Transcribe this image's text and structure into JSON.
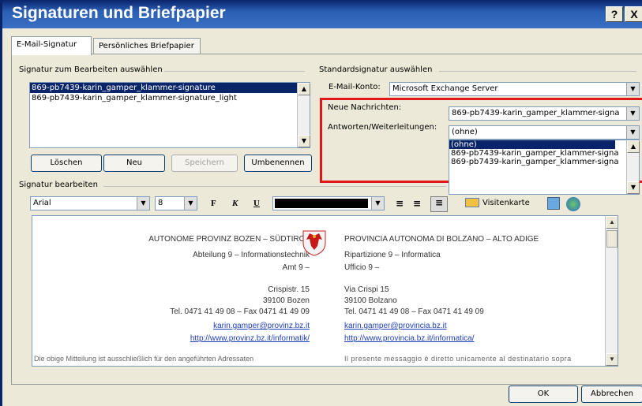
{
  "window": {
    "title": "Signaturen und Briefpapier",
    "help": "?",
    "close": "X"
  },
  "tabs": [
    {
      "label": "E-Mail-Signatur"
    },
    {
      "label": "Persönliches Briefpapier"
    }
  ],
  "left": {
    "group_label": "Signatur zum Bearbeiten auswählen",
    "signatures": [
      "869-pb7439-karin_gamper_klammer-signature",
      "869-pb7439-karin_gamper_klammer-signature_light"
    ],
    "buttons": {
      "delete": "Löschen",
      "new": "Neu",
      "save": "Speichern",
      "rename": "Umbenennen"
    }
  },
  "right": {
    "group_label": "Standardsignatur auswählen",
    "account_label": "E-Mail-Konto:",
    "account_value": "Microsoft Exchange Server",
    "new_messages_label": "Neue Nachrichten:",
    "new_messages_value": "869-pb7439-karin_gamper_klammer-signa",
    "replies_label": "Antworten/Weiterleitungen:",
    "replies_value": "(ohne)",
    "dropdown_options": [
      "(ohne)",
      "869-pb7439-karin_gamper_klammer-signa",
      "869-pb7439-karin_gamper_klammer-signa"
    ]
  },
  "editor": {
    "group_label": "Signatur bearbeiten",
    "font": "Arial",
    "size": "8",
    "bold": "F",
    "italic": "K",
    "underline": "U",
    "vcard": "Visitenkarte"
  },
  "signature": {
    "de_org": "AUTONOME PROVINZ BOZEN – SÜDTIROL",
    "de_dept": "Abteilung 9 – Informationstechnik",
    "de_office": "Amt 9 –",
    "de_street": "Crispistr. 15",
    "de_city": "39100 Bozen",
    "de_tel": "Tel. 0471 41 49 08 – Fax 0471 41 49 09",
    "de_email": "karin.gamper@provinz.bz.it",
    "de_url": "http://www.provinz.bz.it/informatik/",
    "de_disclaimer": "Die obige Mitteilung ist ausschließlich für den angeführten Adressaten",
    "it_org": "PROVINCIA AUTONOMA DI BOLZANO – ALTO ADIGE",
    "it_dept": "Ripartizione 9 – Informatica",
    "it_office": "Ufficio 9 –",
    "it_street": "Via Crispi 15",
    "it_city": "39100 Bolzano",
    "it_tel": "Tel. 0471 41 49 08 – Fax 0471 41 49 09",
    "it_email": "karin.gamper@provincia.bz.it",
    "it_url": "http://www.provincia.bz.it/informatica/",
    "it_disclaimer": "Il presente messaggio è diretto unicamente al destinatario sopra"
  },
  "footer": {
    "ok": "OK",
    "cancel": "Abbrechen"
  },
  "colors": {
    "title_bar": "#0a246a",
    "highlight": "#0a246a",
    "red_outline": "#e01818",
    "link": "#1f3fb0"
  }
}
